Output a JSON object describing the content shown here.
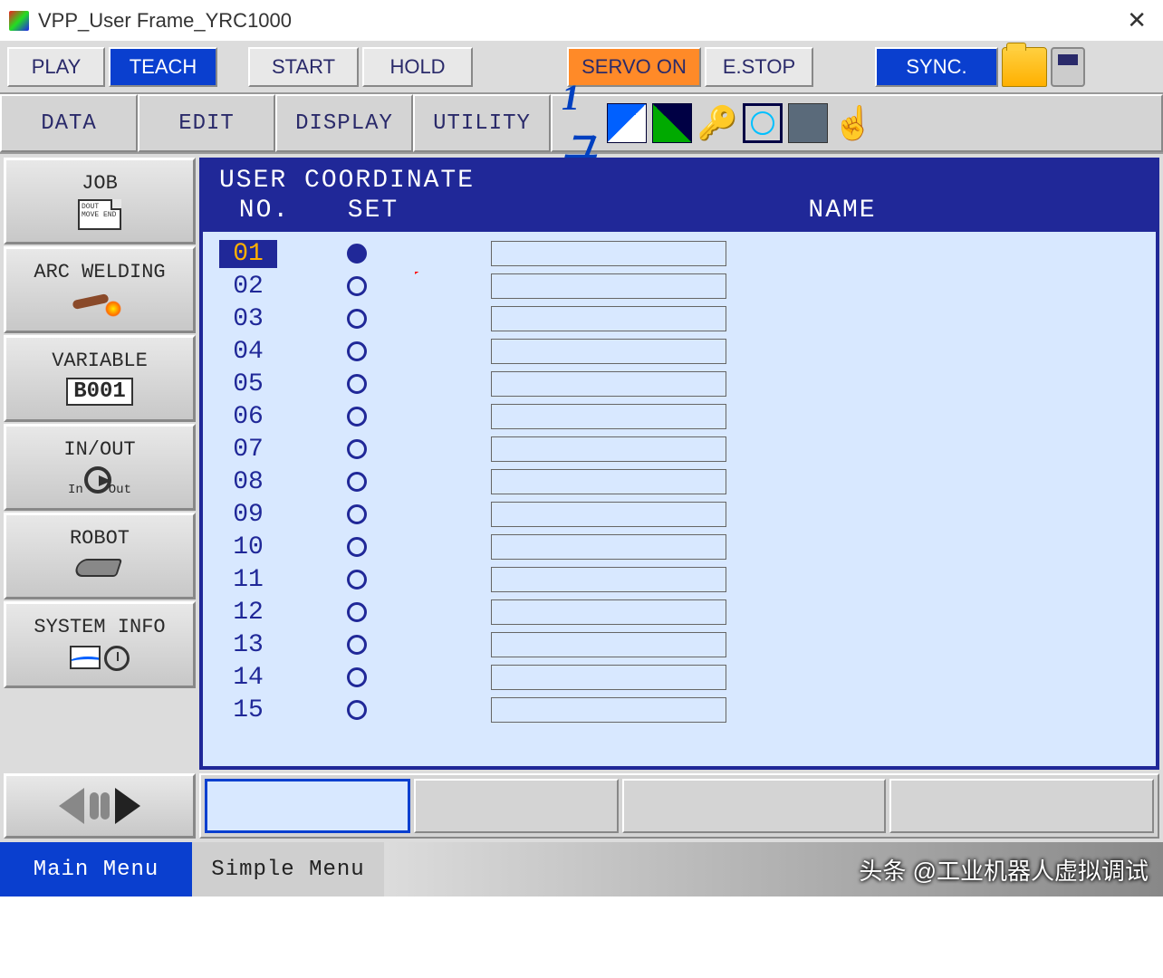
{
  "window": {
    "title": "VPP_User Frame_YRC1000"
  },
  "toolbar": {
    "play": "PLAY",
    "teach": "TEACH",
    "start": "START",
    "hold": "HOLD",
    "servo_on": "SERVO ON",
    "estop": "E.STOP",
    "sync": "SYNC."
  },
  "menu": {
    "data": "DATA",
    "edit": "EDIT",
    "display": "DISPLAY",
    "utility": "UTILITY"
  },
  "sidebar": {
    "job": "JOB",
    "job_doc": "DOUT\nMOVE\nEND",
    "arc": "ARC WELDING",
    "variable": "VARIABLE",
    "variable_value": "B001",
    "inout": "IN/OUT",
    "in_label": "In",
    "out_label": "Out",
    "robot": "ROBOT",
    "sysinfo": "SYSTEM INFO"
  },
  "panel": {
    "title": "USER COORDINATE",
    "col_no": "NO.",
    "col_set": "SET",
    "col_name": "NAME",
    "rows": [
      {
        "no": "01",
        "set": true,
        "name": ""
      },
      {
        "no": "02",
        "set": false,
        "name": ""
      },
      {
        "no": "03",
        "set": false,
        "name": ""
      },
      {
        "no": "04",
        "set": false,
        "name": ""
      },
      {
        "no": "05",
        "set": false,
        "name": ""
      },
      {
        "no": "06",
        "set": false,
        "name": ""
      },
      {
        "no": "07",
        "set": false,
        "name": ""
      },
      {
        "no": "08",
        "set": false,
        "name": ""
      },
      {
        "no": "09",
        "set": false,
        "name": ""
      },
      {
        "no": "10",
        "set": false,
        "name": ""
      },
      {
        "no": "11",
        "set": false,
        "name": ""
      },
      {
        "no": "12",
        "set": false,
        "name": ""
      },
      {
        "no": "13",
        "set": false,
        "name": ""
      },
      {
        "no": "14",
        "set": false,
        "name": ""
      },
      {
        "no": "15",
        "set": false,
        "name": ""
      }
    ]
  },
  "footer": {
    "main": "Main Menu",
    "simple": "Simple Menu"
  },
  "watermark": "头条 @工业机器人虚拟调试"
}
